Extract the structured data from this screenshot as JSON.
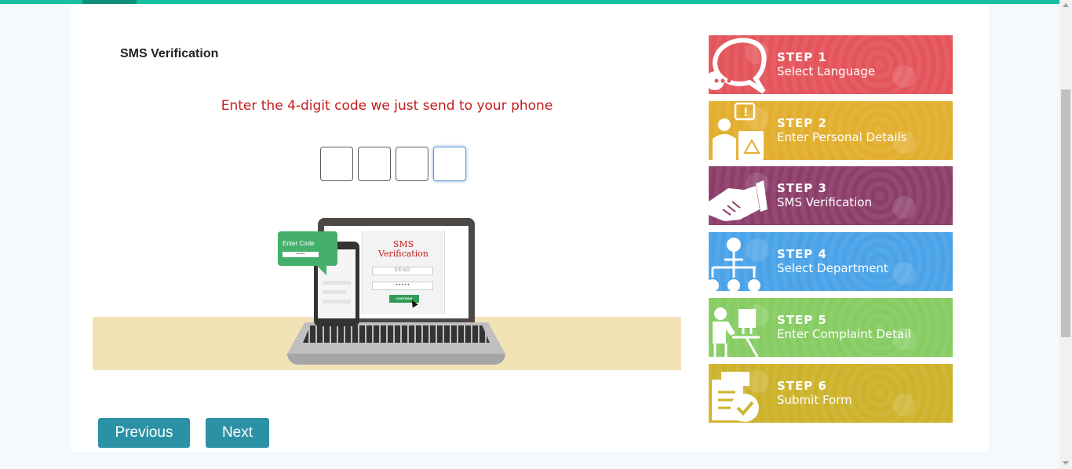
{
  "page": {
    "title": "SMS Verification",
    "instruction": "Enter the 4-digit code we just send to your phone"
  },
  "otp": {
    "digits": [
      "",
      "",
      "",
      ""
    ]
  },
  "illustration": {
    "bubble_label": "Enter Code",
    "bubble_value": "••••••",
    "screen_title_line1": "SMS",
    "screen_title_line2": "Verification",
    "send_label": "SEND",
    "code_mask": "• • • • •",
    "continue_label": "CONTINUE"
  },
  "buttons": {
    "previous": "Previous",
    "next": "Next"
  },
  "steps": [
    {
      "number": "STEP 1",
      "label": "Select Language",
      "color": "#e4545b",
      "icon": "chat-bubble-icon"
    },
    {
      "number": "STEP 2",
      "label": "Enter Personal Details",
      "color": "#e2ae2e",
      "icon": "person-clipboard-icon"
    },
    {
      "number": "STEP 3",
      "label": "SMS Verification",
      "color": "#8c3e6a",
      "icon": "handshake-icon"
    },
    {
      "number": "STEP  4",
      "label": "Select Department",
      "color": "#4aa3e8",
      "icon": "org-chart-icon"
    },
    {
      "number": "STEP  5",
      "label": "Enter Complaint Detail",
      "color": "#86cc62",
      "icon": "person-at-computer-icon"
    },
    {
      "number": "STEP  6",
      "label": "Submit Form",
      "color": "#cdb32c",
      "icon": "form-check-icon"
    }
  ]
}
